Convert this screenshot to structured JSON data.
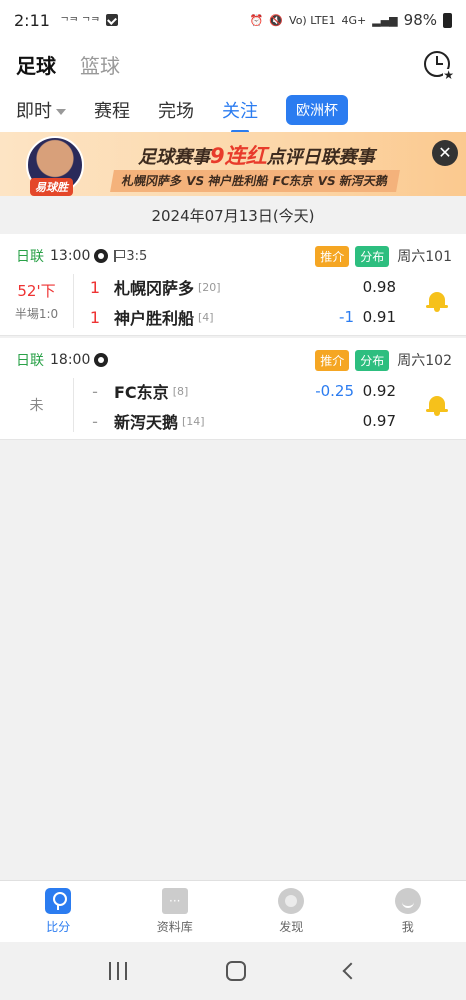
{
  "status_bar": {
    "time": "2:11",
    "carrier_small": "ᄀᄏ ᄀᄏ",
    "network": "4G+",
    "volte": "Vo) LTE1",
    "battery": "98%"
  },
  "top_tabs": [
    "足球",
    "篮球"
  ],
  "sub_tabs": {
    "live": "即时",
    "schedule": "赛程",
    "finished": "完场",
    "following": "关注",
    "euro": "欧洲杯"
  },
  "banner": {
    "headline_pre": "足球赛事",
    "headline_highlight": "9连红",
    "headline_post": "点评日联赛事",
    "sub": "札幌冈萨多 VS 神户胜利船   FC东京 VS 新泻天鹅",
    "tag": "易球胜"
  },
  "date": "2024年07月13日(今天)",
  "matches": [
    {
      "league": "日联",
      "time": "13:00",
      "corner": "3:5",
      "tag1": "推介",
      "tag2": "分布",
      "week": "周六101",
      "status": "52'下",
      "half": "半場1:0",
      "home": {
        "score": "1",
        "name": "札幌冈萨多",
        "rank": "[20]",
        "hcap": "",
        "odds": "0.98"
      },
      "away": {
        "score": "1",
        "name": "神户胜利船",
        "rank": "[4]",
        "hcap": "-1",
        "odds": "0.91"
      }
    },
    {
      "league": "日联",
      "time": "18:00",
      "tag1": "推介",
      "tag2": "分布",
      "week": "周六102",
      "status": "未",
      "home": {
        "score": "-",
        "name": "FC东京",
        "rank": "[8]",
        "hcap": "-0.25",
        "odds": "0.92"
      },
      "away": {
        "score": "-",
        "name": "新泻天鹅",
        "rank": "[14]",
        "hcap": "",
        "odds": "0.97"
      }
    }
  ],
  "bottom_nav": [
    "比分",
    "资料库",
    "发现",
    "我"
  ],
  "colors": {
    "accent": "#2b7cf0",
    "league": "#2aa148",
    "live": "#e33",
    "bell": "#f6c11b"
  }
}
